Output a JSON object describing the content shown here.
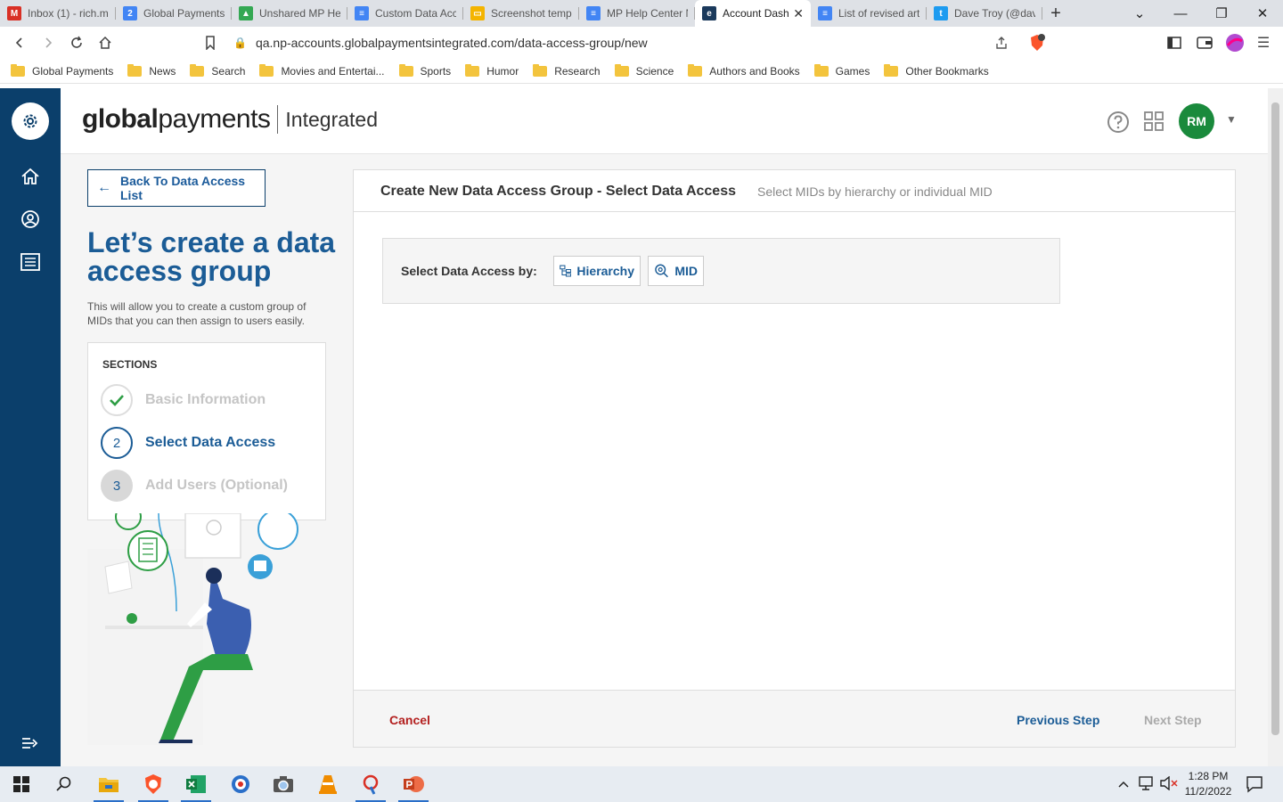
{
  "browser": {
    "tabs": [
      {
        "label": "Inbox (1) - rich.m",
        "fav": "M",
        "color": "#d93025"
      },
      {
        "label": "Global Payments",
        "fav": "2",
        "color": "#4285f4"
      },
      {
        "label": "Unshared MP Hel",
        "fav": "▲",
        "color": "#34a853"
      },
      {
        "label": "Custom Data Acc",
        "fav": "≡",
        "color": "#4285f4"
      },
      {
        "label": "Screenshot temp",
        "fav": "▭",
        "color": "#f4b400"
      },
      {
        "label": "MP Help Center N",
        "fav": "≡",
        "color": "#4285f4"
      },
      {
        "label": "Account Dash",
        "fav": "e",
        "color": "#1b3a5c",
        "active": true
      },
      {
        "label": "List of revised art",
        "fav": "≡",
        "color": "#4285f4"
      },
      {
        "label": "Dave Troy (@dav",
        "fav": "t",
        "color": "#1d9bf0"
      }
    ],
    "url": "qa.np-accounts.globalpaymentsintegrated.com/data-access-group/new",
    "bookmarks": [
      "Global Payments",
      "News",
      "Search",
      "Movies and Entertai...",
      "Sports",
      "Humor",
      "Research",
      "Science",
      "Authors and Books",
      "Games",
      "Other Bookmarks"
    ]
  },
  "header": {
    "logo_bold": "global",
    "logo_regular": "payments",
    "logo_sub": "Integrated",
    "avatar": "RM"
  },
  "left": {
    "back": "Back To Data Access List",
    "heading": "Let’s create a data access group",
    "subtext": "This will allow you to create a custom group of MIDs that you can then assign to users easily.",
    "sections_title": "SECTIONS",
    "steps": [
      {
        "num": "",
        "label": "Basic Information",
        "state": "done"
      },
      {
        "num": "2",
        "label": "Select Data Access",
        "state": "active"
      },
      {
        "num": "3",
        "label": "Add Users (Optional)",
        "state": "pending"
      }
    ]
  },
  "panel": {
    "title": "Create New Data Access Group - Select Data Access",
    "subtitle": "Select MIDs by hierarchy or individual MID",
    "select_label": "Select Data Access by:",
    "option_hierarchy": "Hierarchy",
    "option_mid": "MID",
    "cancel": "Cancel",
    "previous": "Previous Step",
    "next": "Next Step"
  },
  "taskbar": {
    "time": "1:28 PM",
    "date": "11/2/2022"
  }
}
